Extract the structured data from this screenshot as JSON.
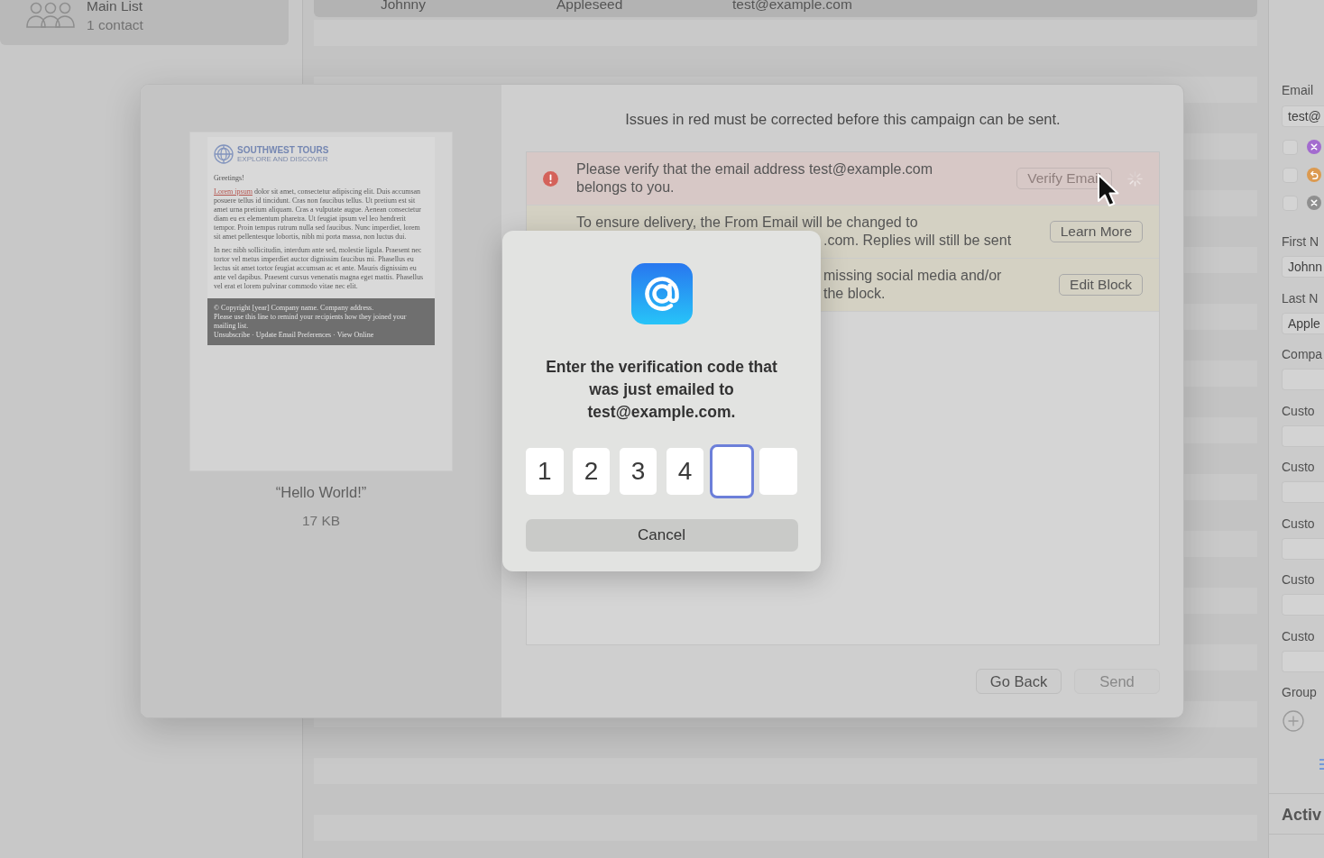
{
  "sidebar": {
    "groups": [
      {
        "name": "Main List",
        "count": "1 contact",
        "selected": true
      }
    ]
  },
  "contacts": {
    "rows": [
      {
        "first_name": "Johnny",
        "last_name": "Appleseed",
        "email": "test@example.com",
        "selected": true
      }
    ]
  },
  "campaign_sheet": {
    "preview": {
      "brand": "SOUTHWEST TOURS",
      "tagline": "EXPLORE AND DISCOVER",
      "greeting": "Greetings!",
      "paragraphs": [
        {
          "link": "Lorem ipsum",
          "text": "dolor sit amet, consectetur adipiscing elit. Duis accumsan posuere tellus id tincidunt. Cras non faucibus tellus. Ut pretium est sit amet urna pretium aliquam. Cras a vulputate augue. Aenean consectetur diam eu ex elementum pharetra. Ut feugiat ipsum vel leo hendrerit tempor. Proin tempus rutrum nulla sed faucibus. Nunc imperdiet, lorem sit amet pellentesque lobortis, nibh mi porta massa, non luctus dui."
        },
        {
          "text": "In nec nibh sollicitudin, interdum ante sed, molestie ligula. Praesent nec tortor vel metus imperdiet auctor dignissim faucibus mi. Phasellus eu lectus sit amet tortor feugiat accumsan ac et ante. Mauris dignissim eu ante vel dapibus. Praesent cursus venenatis magna eget mattis. Phasellus vel erat et lorem pulvinar commodo vitae nec elit."
        }
      ],
      "footer_lines": [
        "© Copyright [year] Company name. Company address.",
        "Please use this line to remind your recipients how they joined your mailing list.",
        "Unsubscribe · Update Email Preferences · View Online"
      ]
    },
    "preview_title": "“Hello World!”",
    "preview_size": "17 KB",
    "notice": "Issues in red must be corrected before this campaign can be sent.",
    "issues": [
      {
        "kind": "error",
        "lines": [
          {
            "text": "Please verify that the email address test@example.com belongs to you.",
            "covered": false
          }
        ],
        "button": {
          "label": "Verify Email",
          "disabled": true
        },
        "busy": true
      },
      {
        "kind": "warning",
        "lines": [
          {
            "text": "To ensure delivery, the From Email will be changed to",
            "covered": false
          },
          {
            "text": ".com. Replies will still be sent",
            "covered": true
          }
        ],
        "button": {
          "label": "Learn More",
          "disabled": false
        },
        "busy": false
      },
      {
        "kind": "warning",
        "lines": [
          {
            "text": "missing social media and/or",
            "covered": true
          },
          {
            "text": "the block.",
            "covered": true
          }
        ],
        "button": {
          "label": "Edit Block",
          "disabled": false
        },
        "busy": false
      }
    ],
    "buttons": [
      {
        "label": "Go Back",
        "disabled": false
      },
      {
        "label": "Send",
        "disabled": true
      }
    ]
  },
  "verification_dialog": {
    "message": "Enter the verification code that was just emailed to test@example.com.",
    "code": [
      {
        "value": "1",
        "focused": false
      },
      {
        "value": "2",
        "focused": false
      },
      {
        "value": "3",
        "focused": false
      },
      {
        "value": "4",
        "focused": false
      },
      {
        "focused": true
      },
      {
        "focused": false
      }
    ],
    "cancel": "Cancel"
  },
  "inspector": {
    "email": {
      "label": "Email",
      "value": "test@"
    },
    "email_options": [
      {
        "kind": "cross",
        "color": "#a36bcf",
        "checked": false
      },
      {
        "kind": "return",
        "color": "#dc9a50",
        "checked": false
      },
      {
        "kind": "cross",
        "color": "#8f8f8f",
        "checked": false
      }
    ],
    "fields": [
      {
        "label": "First N",
        "value": "Johnn"
      },
      {
        "label": "Last N",
        "value": "Apple"
      },
      {
        "label": "Compa"
      },
      {
        "label": "Custo"
      },
      {
        "label": "Custo"
      },
      {
        "label": "Custo"
      },
      {
        "label": "Custo"
      },
      {
        "label": "Custo"
      }
    ],
    "groups_label": "Group",
    "section_title": "Activ"
  }
}
